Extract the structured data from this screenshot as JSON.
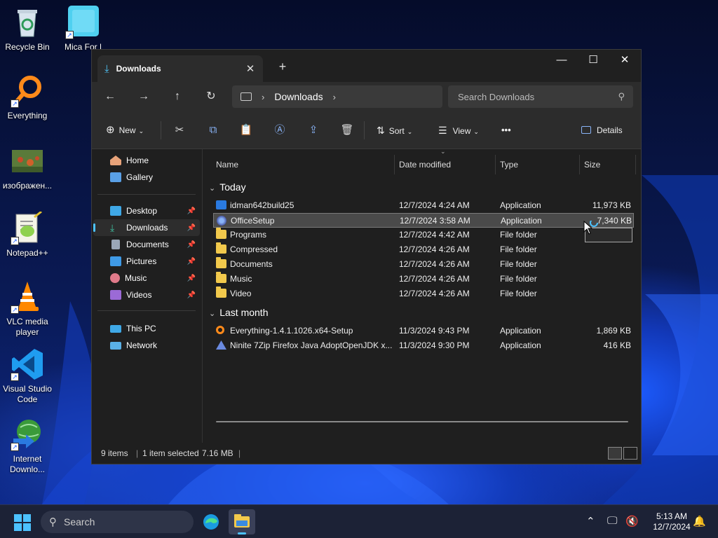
{
  "desktop": {
    "icons": [
      {
        "label": "Recycle Bin"
      },
      {
        "label": "Mica For Everyone"
      },
      {
        "label": "Everything"
      },
      {
        "label": "изображен..."
      },
      {
        "label": "Notepad++"
      },
      {
        "label": "VLC media player"
      },
      {
        "label": "Visual Studio Code"
      },
      {
        "label": "Internet Downlo..."
      }
    ]
  },
  "window": {
    "tab_title": "Downloads",
    "controls": {
      "minimize": "—",
      "maximize": "☐",
      "close": "✕"
    },
    "address": {
      "location": "Downloads"
    },
    "search": {
      "placeholder": "Search Downloads"
    },
    "toolbar": {
      "new_label": "New",
      "sort_label": "Sort",
      "view_label": "View",
      "more_label": "•••",
      "details_label": "Details"
    },
    "sidebar": {
      "items": [
        {
          "label": "Home",
          "icon": "home-icon",
          "color": "#e8a37a"
        },
        {
          "label": "Gallery",
          "icon": "gallery-icon",
          "color": "#5aa0e6"
        },
        {
          "label": "Desktop",
          "icon": "desktop-icon",
          "color": "#3fa8e6",
          "pinned": true
        },
        {
          "label": "Downloads",
          "icon": "download-icon",
          "color": "#3fc2a2",
          "pinned": true,
          "selected": true
        },
        {
          "label": "Documents",
          "icon": "documents-icon",
          "color": "#9aa7b8",
          "pinned": true
        },
        {
          "label": "Pictures",
          "icon": "pictures-icon",
          "color": "#3f9ae6",
          "pinned": true
        },
        {
          "label": "Music",
          "icon": "music-icon",
          "color": "#e07a8a",
          "pinned": true
        },
        {
          "label": "Videos",
          "icon": "videos-icon",
          "color": "#9b6ad6",
          "pinned": true
        },
        {
          "label": "This PC",
          "icon": "this-pc-icon",
          "color": "#3fa8e6"
        },
        {
          "label": "Network",
          "icon": "network-icon",
          "color": "#5ab0e6"
        }
      ]
    },
    "columns": {
      "name": "Name",
      "date": "Date modified",
      "type": "Type",
      "size": "Size"
    },
    "groups": [
      {
        "label": "Today",
        "rows": [
          {
            "name": "idman642build25",
            "date": "12/7/2024 4:24 AM",
            "type": "Application",
            "size": "11,973 KB",
            "icon": "idm-app-icon"
          },
          {
            "name": "OfficeSetup",
            "date": "12/7/2024 3:58 AM",
            "type": "Application",
            "size": "7,340 KB",
            "icon": "office-app-icon",
            "selected": true
          },
          {
            "name": "Programs",
            "date": "12/7/2024 4:42 AM",
            "type": "File folder",
            "size": "",
            "icon": "folder-icon"
          },
          {
            "name": "Compressed",
            "date": "12/7/2024 4:26 AM",
            "type": "File folder",
            "size": "",
            "icon": "folder-icon"
          },
          {
            "name": "Documents",
            "date": "12/7/2024 4:26 AM",
            "type": "File folder",
            "size": "",
            "icon": "folder-icon"
          },
          {
            "name": "Music",
            "date": "12/7/2024 4:26 AM",
            "type": "File folder",
            "size": "",
            "icon": "folder-icon"
          },
          {
            "name": "Video",
            "date": "12/7/2024 4:26 AM",
            "type": "File folder",
            "size": "",
            "icon": "folder-icon"
          }
        ]
      },
      {
        "label": "Last month",
        "rows": [
          {
            "name": "Everything-1.4.1.1026.x64-Setup",
            "date": "11/3/2024 9:43 PM",
            "type": "Application",
            "size": "1,869 KB",
            "icon": "everything-app-icon"
          },
          {
            "name": "Ninite 7Zip Firefox Java AdoptOpenJDK x...",
            "date": "11/3/2024 9:30 PM",
            "type": "Application",
            "size": "416 KB",
            "icon": "ninite-app-icon"
          }
        ]
      }
    ],
    "status": {
      "items": "9 items",
      "selection": "1 item selected",
      "size": "7.16 MB"
    }
  },
  "taskbar": {
    "search_label": "Search",
    "time": "5:13 AM",
    "date": "12/7/2024"
  }
}
